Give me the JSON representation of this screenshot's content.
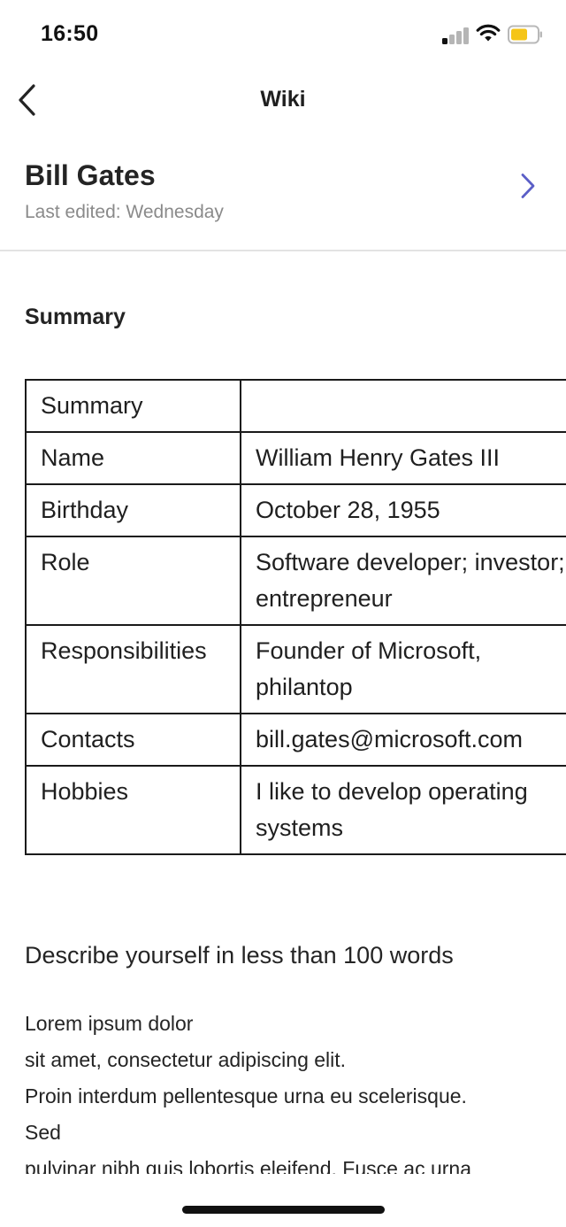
{
  "status_bar": {
    "time": "16:50",
    "icons": [
      "cellular-signal-icon",
      "wifi-icon",
      "battery-icon"
    ],
    "battery_color": "#f5c518"
  },
  "nav": {
    "title": "Wiki",
    "back_icon": "chevron-left-icon"
  },
  "page": {
    "title": "Bill Gates",
    "last_edited": "Last edited: Wednesday",
    "forward_icon": "chevron-right-icon",
    "accent_color": "#5b5fc7"
  },
  "section_heading": "Summary",
  "table": {
    "rows": [
      [
        "Summary",
        ""
      ],
      [
        "Name",
        "William Henry Gates III"
      ],
      [
        "Birthday",
        "October 28, 1955"
      ],
      [
        "Role",
        "Software developer; investor; entrepreneur"
      ],
      [
        "Responsibilities",
        "Founder of Microsoft, philantop"
      ],
      [
        "Contacts",
        "bill.gates@microsoft.com"
      ],
      [
        "Hobbies",
        "I like to develop operating systems"
      ]
    ]
  },
  "describe": {
    "heading": "Describe yourself in less than 100 words",
    "lines": [
      "Lorem ipsum dolor",
      "sit amet, consectetur adipiscing elit.",
      "Proin interdum pellentesque urna eu scelerisque.",
      "Sed",
      "pulvinar nibh quis lobortis eleifend. Fusce ac urna"
    ]
  }
}
